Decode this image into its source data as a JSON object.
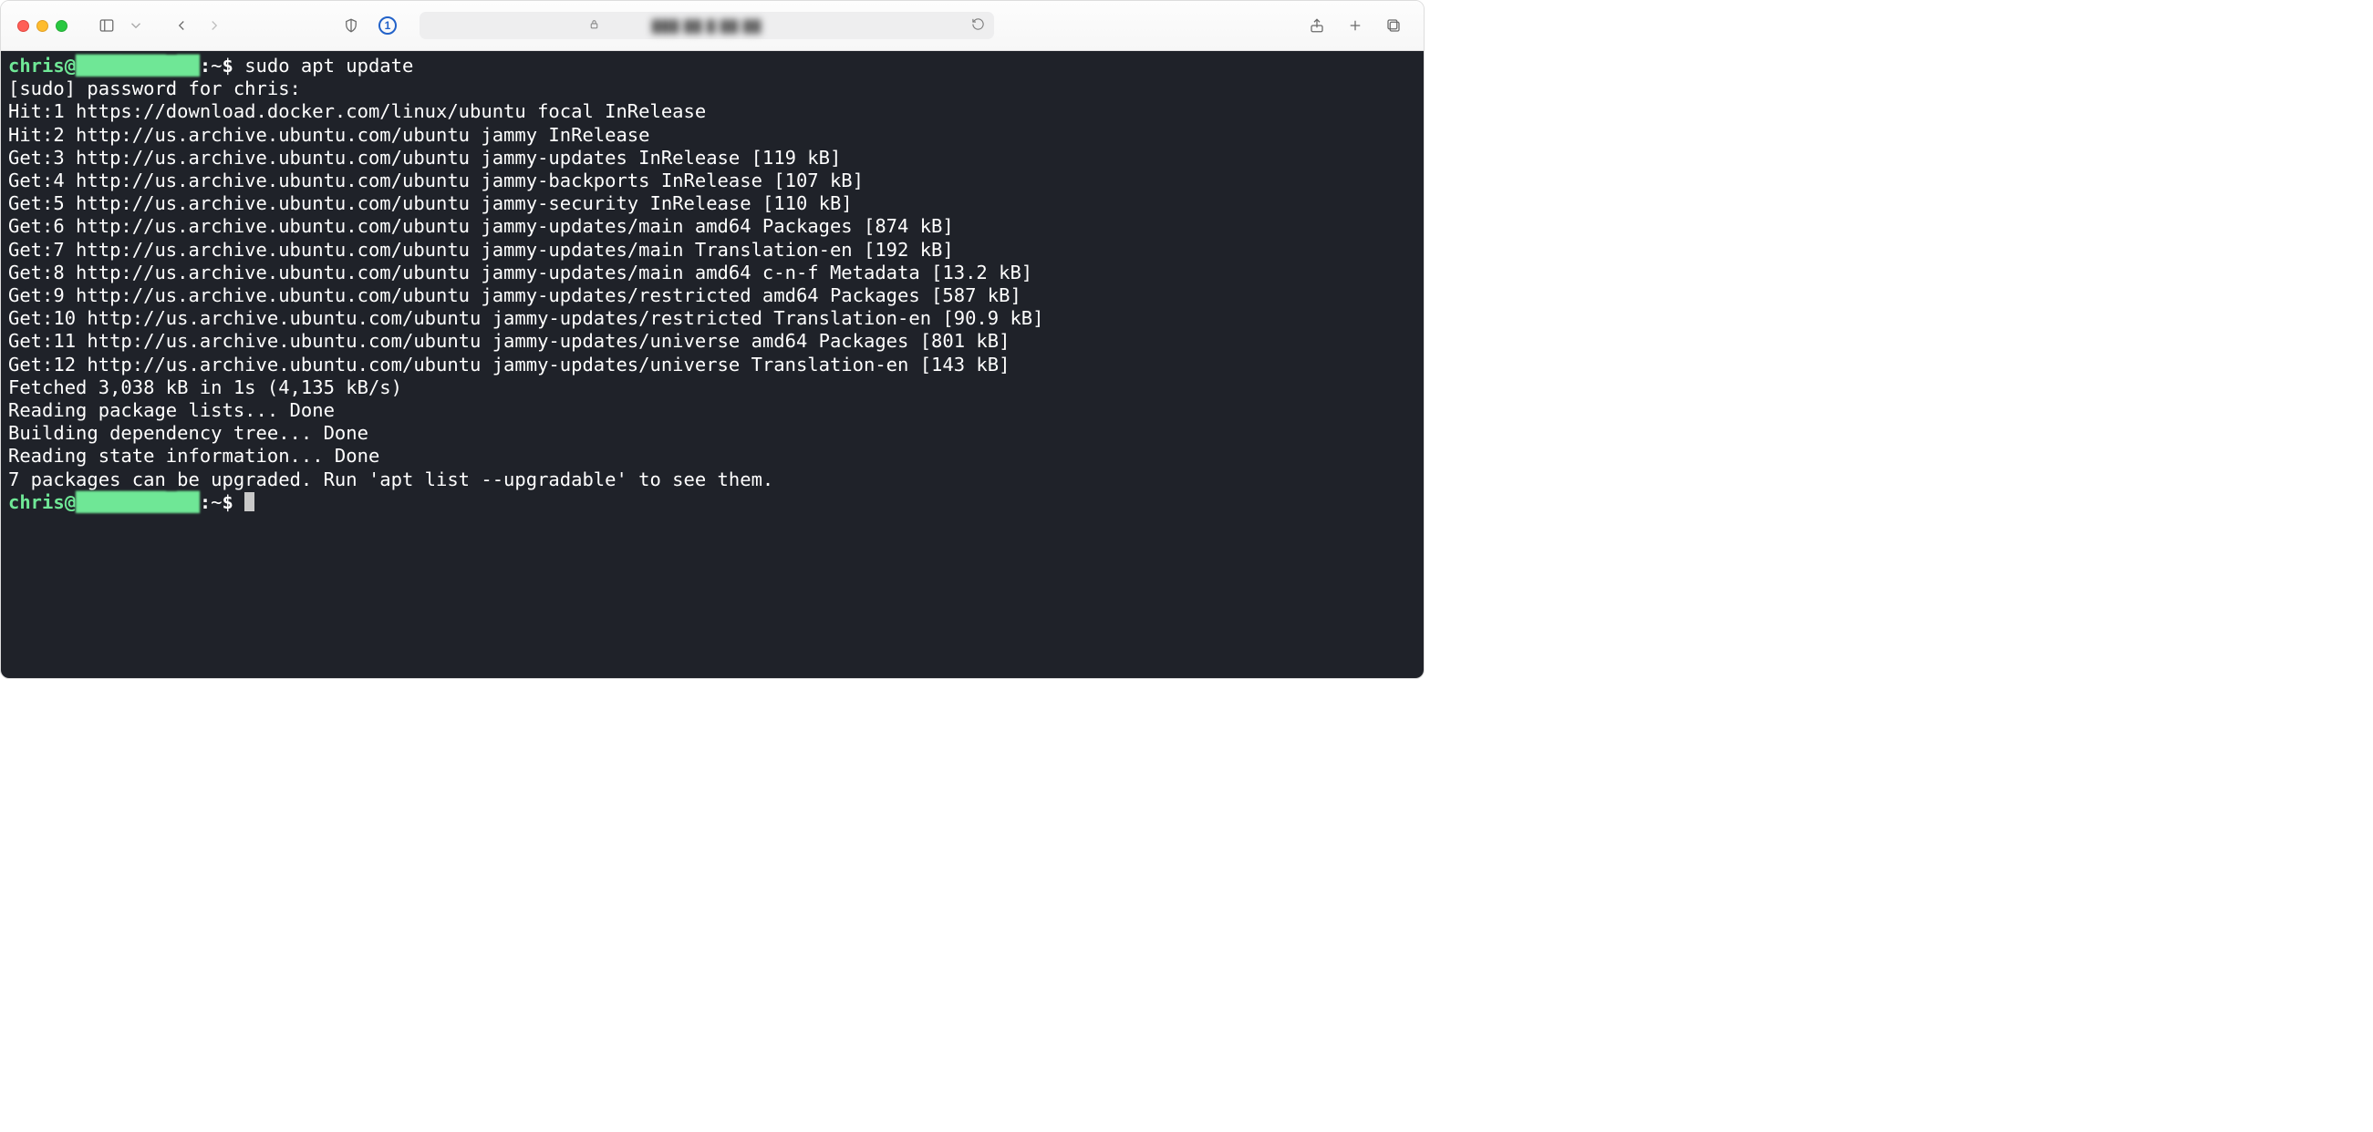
{
  "toolbar": {
    "url_display": "███ ██ █ ██  ██",
    "lock_icon": "lock",
    "onepassword_label": "1"
  },
  "terminal": {
    "prompt1": {
      "user": "chris@",
      "host_obscured": "████████ ██",
      "sep": ":",
      "path": "~",
      "sigil": "$",
      "command": "sudo apt update"
    },
    "lines": [
      "[sudo] password for chris:",
      "Hit:1 https://download.docker.com/linux/ubuntu focal InRelease",
      "Hit:2 http://us.archive.ubuntu.com/ubuntu jammy InRelease",
      "Get:3 http://us.archive.ubuntu.com/ubuntu jammy-updates InRelease [119 kB]",
      "Get:4 http://us.archive.ubuntu.com/ubuntu jammy-backports InRelease [107 kB]",
      "Get:5 http://us.archive.ubuntu.com/ubuntu jammy-security InRelease [110 kB]",
      "Get:6 http://us.archive.ubuntu.com/ubuntu jammy-updates/main amd64 Packages [874 kB]",
      "Get:7 http://us.archive.ubuntu.com/ubuntu jammy-updates/main Translation-en [192 kB]",
      "Get:8 http://us.archive.ubuntu.com/ubuntu jammy-updates/main amd64 c-n-f Metadata [13.2 kB]",
      "Get:9 http://us.archive.ubuntu.com/ubuntu jammy-updates/restricted amd64 Packages [587 kB]",
      "Get:10 http://us.archive.ubuntu.com/ubuntu jammy-updates/restricted Translation-en [90.9 kB]",
      "Get:11 http://us.archive.ubuntu.com/ubuntu jammy-updates/universe amd64 Packages [801 kB]",
      "Get:12 http://us.archive.ubuntu.com/ubuntu jammy-updates/universe Translation-en [143 kB]",
      "Fetched 3,038 kB in 1s (4,135 kB/s)",
      "Reading package lists... Done",
      "Building dependency tree... Done",
      "Reading state information... Done",
      "7 packages can be upgraded. Run 'apt list --upgradable' to see them."
    ],
    "prompt2": {
      "user": "chris@",
      "host_obscured": "████████ ██",
      "sep": ":",
      "path": "~",
      "sigil": "$"
    }
  }
}
